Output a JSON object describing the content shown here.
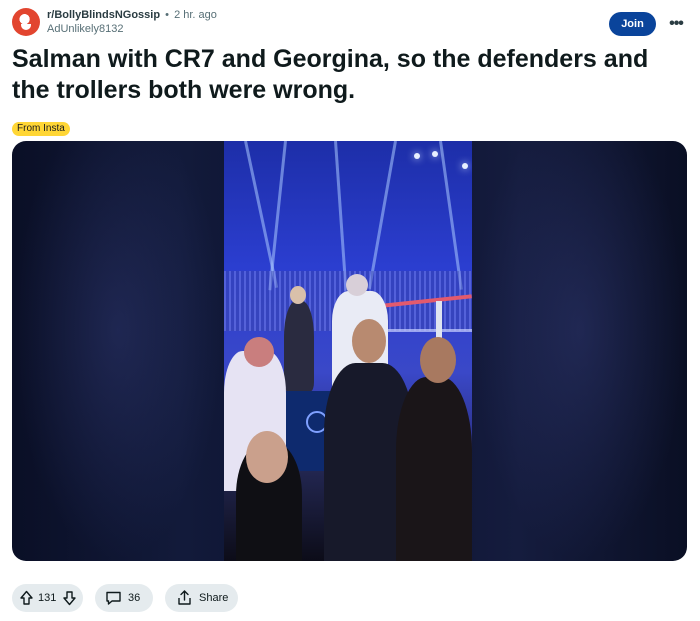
{
  "post": {
    "subreddit": "r/BollyBlindsNGossip",
    "separator": "•",
    "time_ago": "2 hr. ago",
    "author": "AdUnlikely8132",
    "title": "Salman with CR7 and Georgina, so the defenders and the trollers both were wrong.",
    "flair": "From Insta"
  },
  "header": {
    "join_label": "Join",
    "more_label": "•••"
  },
  "actions": {
    "upvotes": "131",
    "comments": "36",
    "share_label": "Share"
  },
  "colors": {
    "join_button": "#0a449b",
    "flair_bg": "#ffd635",
    "pill_bg": "#e5ebee"
  },
  "icons": {
    "upvote": "upvote-arrow-icon",
    "downvote": "downvote-arrow-icon",
    "comment": "comment-bubble-icon",
    "share": "share-icon",
    "more": "more-dots-icon"
  }
}
